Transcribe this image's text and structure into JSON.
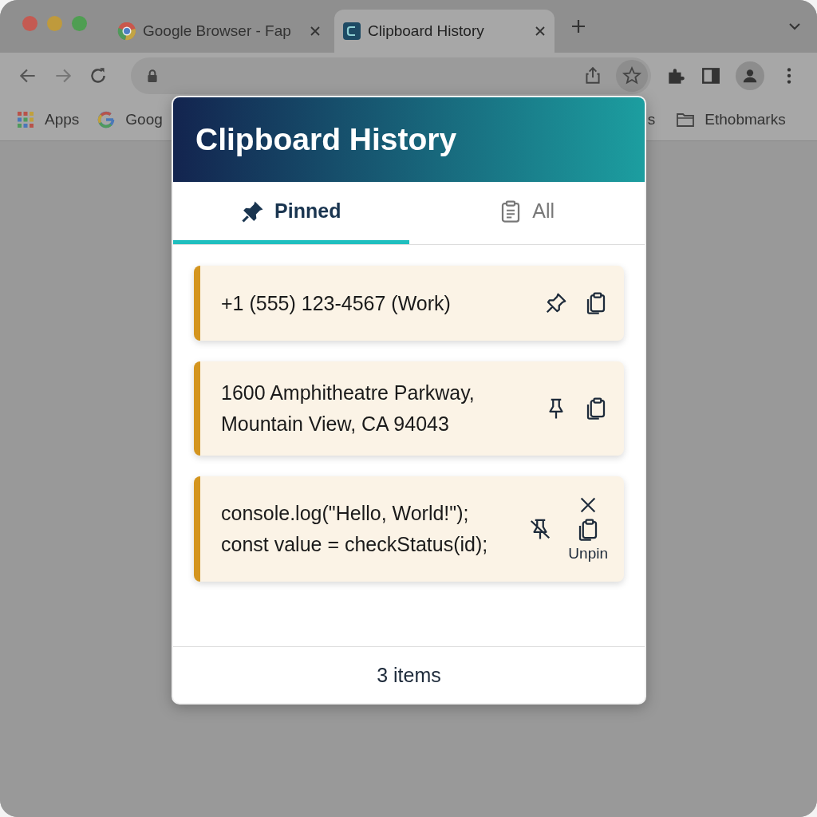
{
  "browser": {
    "tabs": [
      {
        "title": "Google Browser - Fap",
        "selected": false
      },
      {
        "title": "Clipboard History",
        "selected": true
      }
    ],
    "bookmarks": [
      {
        "kind": "apps",
        "label": "Apps"
      },
      {
        "kind": "google",
        "label": "Goog"
      },
      {
        "kind": "fragment",
        "label": "s"
      },
      {
        "kind": "folder",
        "label": "Ethobmarks"
      }
    ]
  },
  "popup": {
    "title": "Clipboard History",
    "tabs": [
      {
        "label": "Pinned",
        "selected": true
      },
      {
        "label": "All",
        "selected": false
      }
    ],
    "items": [
      {
        "lines": [
          "+1 (555) 123-4567 (Work)"
        ],
        "kind": "tilted",
        "close_button": false
      },
      {
        "lines": [
          "1600 Amphitheatre Parkway,",
          "Mountain View, CA 94043"
        ],
        "kind": "upright",
        "close_button": false
      },
      {
        "lines": [
          "console.log(\"Hello, World!\");",
          "const value = checkStatus(id);"
        ],
        "kind": "slashed",
        "close_button": true,
        "tooltip": "Unpin"
      }
    ],
    "footer": "3 items"
  }
}
